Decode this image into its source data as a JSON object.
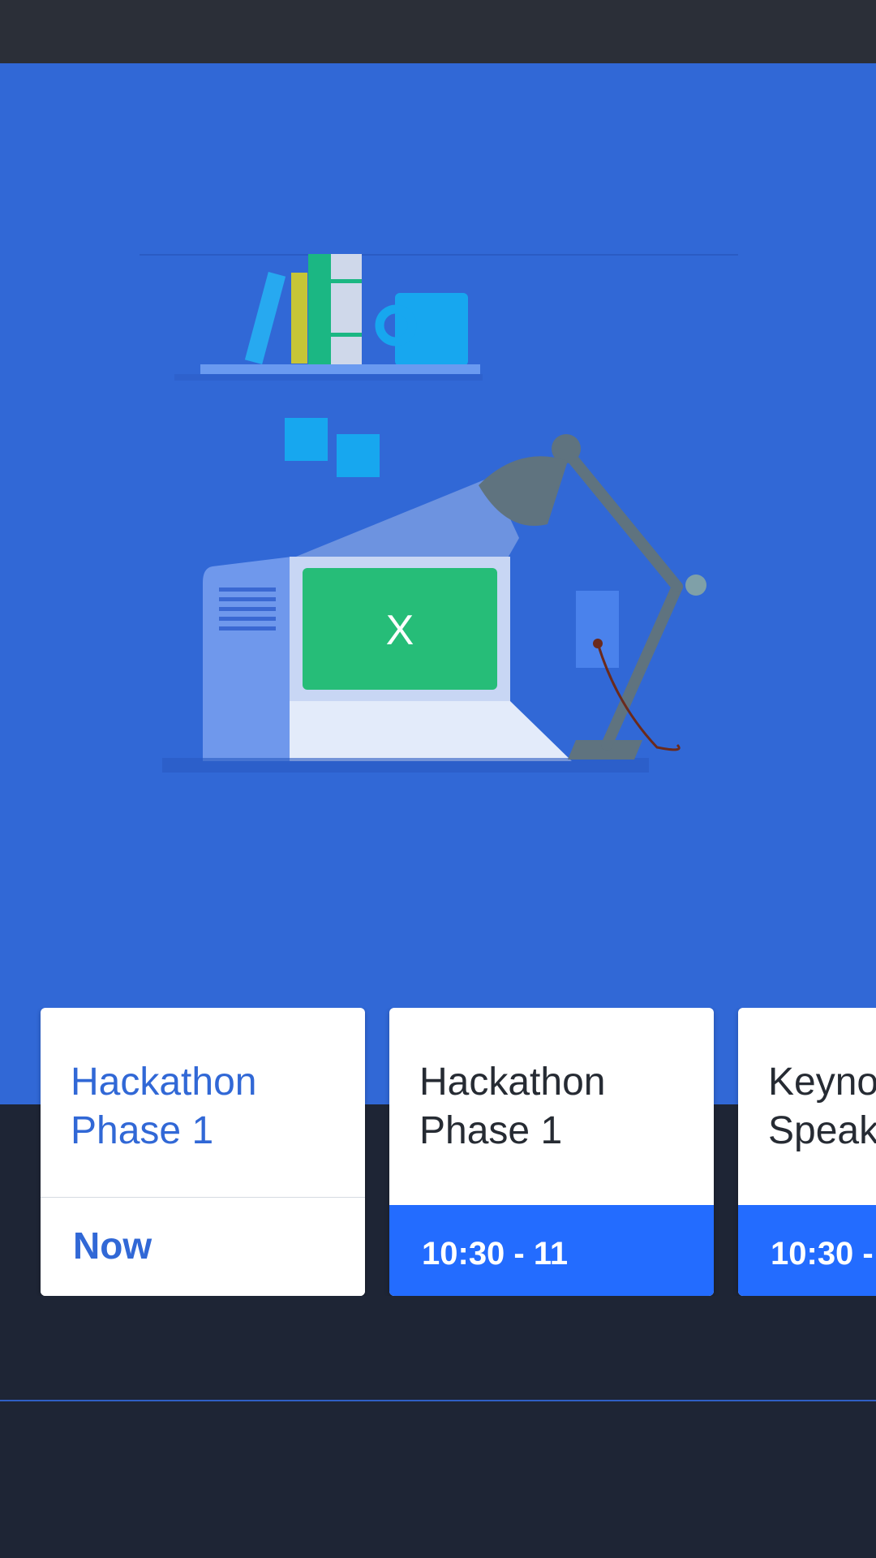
{
  "colors": {
    "status_bar": "#2b2f38",
    "hero_background": "#3168d6",
    "bottom_background": "#1e2535",
    "card_time_background": "#236cff",
    "accent": "#3168d6"
  },
  "hero": {
    "screen_letter": "X",
    "illustration": "desk-computer-lamp-illustration"
  },
  "sessions": [
    {
      "title_line1": "Hackathon",
      "title_line2": "Phase 1",
      "time": "Now",
      "active": true
    },
    {
      "title_line1": "Hackathon",
      "title_line2": "Phase 1",
      "time": "10:30 - 11",
      "active": false
    },
    {
      "title_line1": "Keyno",
      "title_line2": "Speak",
      "time": "10:30 -",
      "active": false
    }
  ]
}
